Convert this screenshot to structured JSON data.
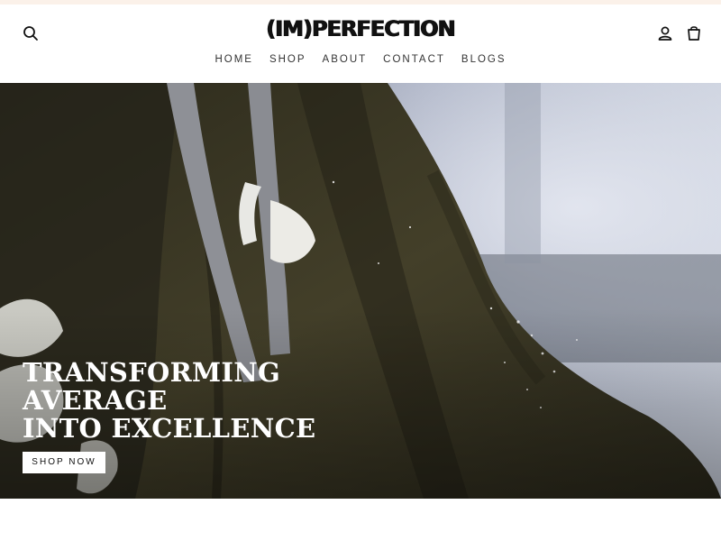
{
  "header": {
    "logo_text": "(IM)PERFECTION",
    "icons": {
      "search": "search-icon",
      "account": "account-icon",
      "cart": "cart-icon"
    }
  },
  "nav": {
    "items": [
      {
        "label": "HOME"
      },
      {
        "label": "SHOP"
      },
      {
        "label": "ABOUT"
      },
      {
        "label": "CONTACT"
      },
      {
        "label": "BLOGS"
      }
    ]
  },
  "hero": {
    "title_lines": [
      "TRANSFORMING",
      "AVERAGE",
      "INTO EXCELLENCE"
    ],
    "cta_label": "SHOP NOW"
  },
  "colors": {
    "topstrip": "#fbf1e9",
    "hoodie_olive": "#3f3b27",
    "text_dark": "#111111"
  }
}
